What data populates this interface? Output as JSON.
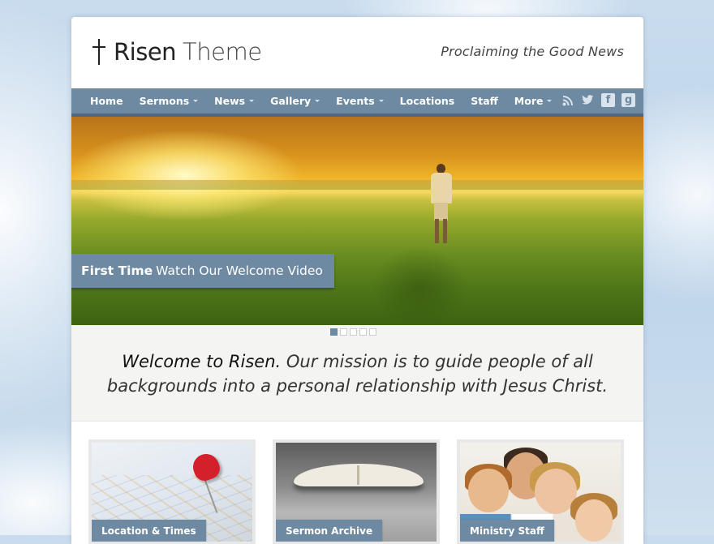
{
  "site": {
    "logo_name_bold": "Risen",
    "logo_name_light": "Theme",
    "tagline": "Proclaiming the Good News"
  },
  "nav": {
    "items": [
      {
        "label": "Home",
        "has_dropdown": false
      },
      {
        "label": "Sermons",
        "has_dropdown": true
      },
      {
        "label": "News",
        "has_dropdown": true
      },
      {
        "label": "Gallery",
        "has_dropdown": true
      },
      {
        "label": "Events",
        "has_dropdown": true
      },
      {
        "label": "Locations",
        "has_dropdown": false
      },
      {
        "label": "Staff",
        "has_dropdown": false
      },
      {
        "label": "More",
        "has_dropdown": true
      }
    ],
    "social_icons": [
      "rss-icon",
      "twitter-icon",
      "facebook-icon",
      "google-plus-icon"
    ]
  },
  "hero": {
    "cta_bold": "First Time",
    "cta_text": "Watch Our Welcome Video",
    "slide_count": 5,
    "active_slide": 1
  },
  "welcome": {
    "lead": "Welcome to Risen.",
    "text": "Our mission is to guide people of all backgrounds into a personal relationship with Jesus Christ."
  },
  "cards": [
    {
      "label": "Location & Times"
    },
    {
      "label": "Sermon Archive"
    },
    {
      "label": "Ministry Staff"
    }
  ],
  "colors": {
    "accent": "#6e8aa3",
    "accent_dark": "#50687f",
    "text": "#333333"
  }
}
